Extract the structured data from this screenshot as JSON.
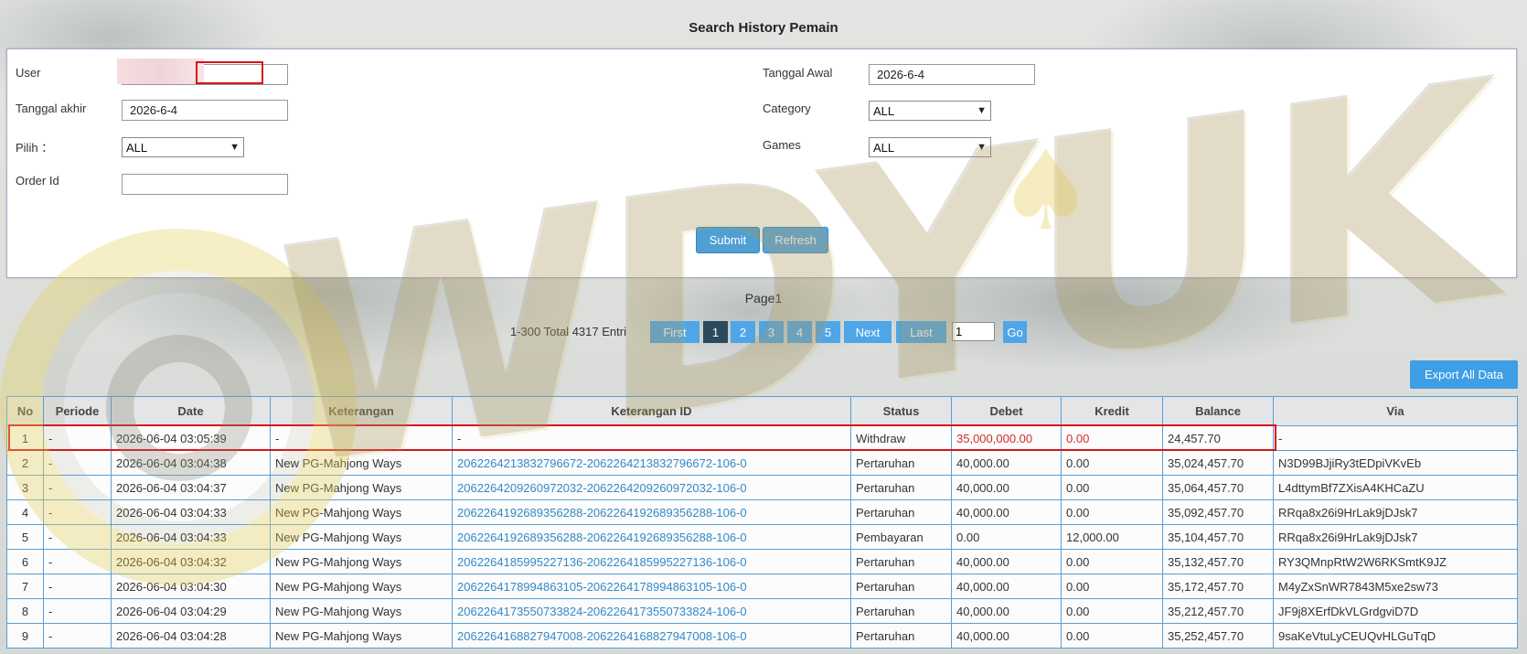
{
  "page_title": "Search History Pemain",
  "form": {
    "user_label": "User",
    "user_value": "",
    "tanggal_akhir_label": "Tanggal akhir",
    "tanggal_akhir_value": "2026-6-4",
    "pilih_label": "Pilih ：",
    "pilih_value": "ALL",
    "order_id_label": "Order Id",
    "order_id_value": "",
    "tanggal_awal_label": "Tanggal Awal",
    "tanggal_awal_value": "2026-6-4",
    "category_label": "Category",
    "category_value": "ALL",
    "games_label": "Games",
    "games_value": "ALL",
    "submit_label": "Submit",
    "refresh_label": "Refresh"
  },
  "pagination": {
    "page_label": "Page1",
    "info": "1-300 Total 4317 Entri",
    "first": "First",
    "pages": [
      "1",
      "2",
      "3",
      "4",
      "5"
    ],
    "active_page": "1",
    "next": "Next",
    "last": "Last",
    "go_input": "1",
    "go": "Go"
  },
  "export_label": "Export All Data",
  "watermark": "WDYUK",
  "table": {
    "headers": [
      "No",
      "Periode",
      "Date",
      "Keterangan",
      "Keterangan ID",
      "Status",
      "Debet",
      "Kredit",
      "Balance",
      "Via"
    ],
    "rows": [
      [
        "1",
        "-",
        "2026-06-04 03:05:39",
        "-",
        "-",
        "Withdraw",
        "35,000,000.00",
        "0.00",
        "24,457.70",
        "-"
      ],
      [
        "2",
        "-",
        "2026-06-04 03:04:38",
        "New PG-Mahjong Ways",
        "206226421383279​6672-2062264213832796672-106-0",
        "Pertaruhan",
        "40,000.00",
        "0.00",
        "35,024,457.70",
        "N3D99BJjiRy3tEDpiVKvEb"
      ],
      [
        "3",
        "-",
        "2026-06-04 03:04:37",
        "New PG-Mahjong Ways",
        "2062264209260972032-2062264209260972032-106-0",
        "Pertaruhan",
        "40,000.00",
        "0.00",
        "35,064,457.70",
        "L4dttymBf7ZXisA4KHCaZU"
      ],
      [
        "4",
        "-",
        "2026-06-04 03:04:33",
        "New PG-Mahjong Ways",
        "2062264192689356288-2062264192689356288-106-0",
        "Pertaruhan",
        "40,000.00",
        "0.00",
        "35,092,457.70",
        "RRqa8x26i9HrLak9jDJsk7"
      ],
      [
        "5",
        "-",
        "2026-06-04 03:04:33",
        "New PG-Mahjong Ways",
        "2062264192689356288-2062264192689356288-106-0",
        "Pembayaran",
        "0.00",
        "12,000.00",
        "35,104,457.70",
        "RRqa8x26i9HrLak9jDJsk7"
      ],
      [
        "6",
        "-",
        "2026-06-04 03:04:32",
        "New PG-Mahjong Ways",
        "2062264185995227136-2062264185995227136-106-0",
        "Pertaruhan",
        "40,000.00",
        "0.00",
        "35,132,457.70",
        "RY3QMnpRtW2W6RKSmtK9JZ"
      ],
      [
        "7",
        "-",
        "2026-06-04 03:04:30",
        "New PG-Mahjong Ways",
        "2062264178994863105-2062264178994863105-106-0",
        "Pertaruhan",
        "40,000.00",
        "0.00",
        "35,172,457.70",
        "M4yZxSnWR7843M5xe2sw73"
      ],
      [
        "8",
        "-",
        "2026-06-04 03:04:29",
        "New PG-Mahjong Ways",
        "2062264173550733824-2062264173550733824-106-0",
        "Pertaruhan",
        "40,000.00",
        "0.00",
        "35,212,457.70",
        "JF9j8XErfDkVLGrdgviD7D"
      ],
      [
        "9",
        "-",
        "2026-06-04 03:04:28",
        "New PG-Mahjong Ways",
        "2062264168827947008-2062264168827947008-106-0",
        "Pertaruhan",
        "40,000.00",
        "0.00",
        "35,252,457.70",
        "9saKeVtuLyCEUQvHLGuTqD"
      ]
    ]
  }
}
